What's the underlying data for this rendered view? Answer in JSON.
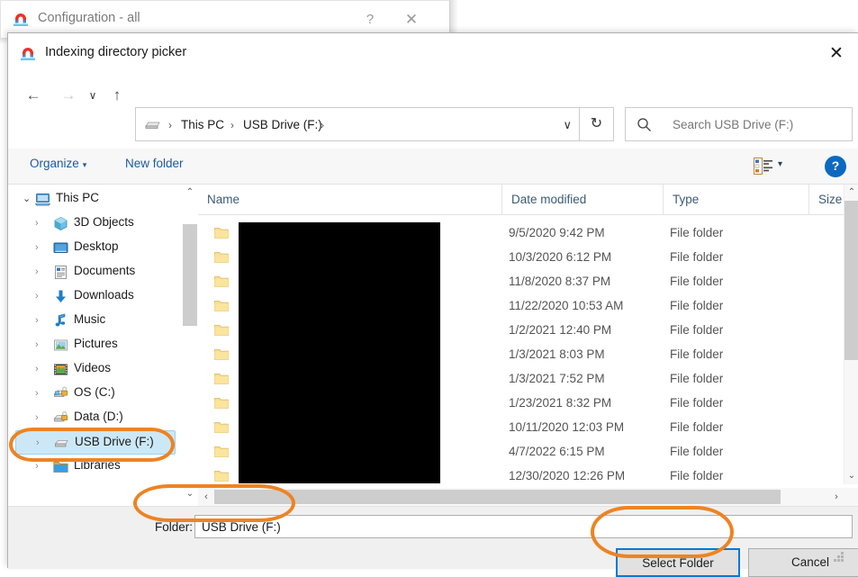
{
  "background_window": {
    "title": "Configuration - all",
    "icon": "everything-magnet-icon",
    "help_label": "?",
    "close_label": "✕"
  },
  "dialog": {
    "title": "Indexing directory picker",
    "icon": "everything-magnet-icon",
    "close_label": "✕"
  },
  "navigation": {
    "back_label": "←",
    "forward_label": "→",
    "recent_label": "∨",
    "up_label": "↑"
  },
  "address_bar": {
    "drive_icon": "usb-drive-icon",
    "crumbs": [
      "This PC",
      "USB Drive (F:)"
    ],
    "separator": "›",
    "dropdown_label": "∨",
    "refresh_label": "↻"
  },
  "search": {
    "icon": "search-icon",
    "placeholder": "Search USB Drive (F:)"
  },
  "toolbar": {
    "organize_label": "Organize",
    "organize_caret": "▾",
    "new_folder_label": "New folder",
    "view_icon": "view-list-icon",
    "view_caret": "▾",
    "help_label": "?"
  },
  "nav_pane": {
    "items": [
      {
        "label": "This PC",
        "level": "root",
        "icon": "this-pc-icon",
        "expanded": true,
        "chevron": "⌄",
        "selected": false
      },
      {
        "label": "3D Objects",
        "level": "child",
        "icon": "3d-objects-icon",
        "expanded": false,
        "chevron": "›",
        "selected": false
      },
      {
        "label": "Desktop",
        "level": "child",
        "icon": "desktop-icon",
        "expanded": false,
        "chevron": "›",
        "selected": false
      },
      {
        "label": "Documents",
        "level": "child",
        "icon": "documents-icon",
        "expanded": false,
        "chevron": "›",
        "selected": false
      },
      {
        "label": "Downloads",
        "level": "child",
        "icon": "downloads-icon",
        "expanded": false,
        "chevron": "›",
        "selected": false
      },
      {
        "label": "Music",
        "level": "child",
        "icon": "music-icon",
        "expanded": false,
        "chevron": "›",
        "selected": false
      },
      {
        "label": "Pictures",
        "level": "child",
        "icon": "pictures-icon",
        "expanded": false,
        "chevron": "›",
        "selected": false
      },
      {
        "label": "Videos",
        "level": "child",
        "icon": "videos-icon",
        "expanded": false,
        "chevron": "›",
        "selected": false
      },
      {
        "label": "OS (C:)",
        "level": "child",
        "icon": "os-drive-icon",
        "expanded": false,
        "chevron": "›",
        "selected": false
      },
      {
        "label": "Data (D:)",
        "level": "child",
        "icon": "hard-drive-icon",
        "expanded": false,
        "chevron": "›",
        "selected": false
      },
      {
        "label": "USB Drive (F:)",
        "level": "child",
        "icon": "usb-drive-icon",
        "expanded": false,
        "chevron": "›",
        "selected": true
      },
      {
        "label": "Libraries",
        "level": "child",
        "icon": "libraries-icon",
        "expanded": false,
        "chevron": "›",
        "selected": false
      }
    ],
    "scroll_up": "⌃",
    "scroll_down": "⌄"
  },
  "file_list": {
    "columns": [
      "Name",
      "Date modified",
      "Type",
      "Size"
    ],
    "sort_indicator": "⌃",
    "name_redacted": true,
    "rows": [
      {
        "name": "",
        "date_modified": "9/5/2020 9:42 PM",
        "type": "File folder",
        "size": ""
      },
      {
        "name": "",
        "date_modified": "10/3/2020 6:12 PM",
        "type": "File folder",
        "size": ""
      },
      {
        "name": "",
        "date_modified": "11/8/2020 8:37 PM",
        "type": "File folder",
        "size": ""
      },
      {
        "name": "",
        "date_modified": "11/22/2020 10:53 AM",
        "type": "File folder",
        "size": ""
      },
      {
        "name": "",
        "date_modified": "1/2/2021 12:40 PM",
        "type": "File folder",
        "size": ""
      },
      {
        "name": "",
        "date_modified": "1/3/2021 8:03 PM",
        "type": "File folder",
        "size": ""
      },
      {
        "name": "",
        "date_modified": "1/3/2021 7:52 PM",
        "type": "File folder",
        "size": ""
      },
      {
        "name": "",
        "date_modified": "1/23/2021 8:32 PM",
        "type": "File folder",
        "size": ""
      },
      {
        "name": "",
        "date_modified": "10/11/2020 12:03 PM",
        "type": "File folder",
        "size": ""
      },
      {
        "name": "",
        "date_modified": "4/7/2022 6:15 PM",
        "type": "File folder",
        "size": ""
      },
      {
        "name": "",
        "date_modified": "12/30/2020 12:26 PM",
        "type": "File folder",
        "size": ""
      }
    ],
    "vscroll_up": "⌃",
    "vscroll_down": "⌄",
    "hscroll_left": "‹",
    "hscroll_right": "›"
  },
  "folder_field": {
    "label": "Folder:",
    "value": "USB Drive (F:)"
  },
  "buttons": {
    "select_folder": "Select Folder",
    "cancel": "Cancel"
  },
  "colors": {
    "annotation_orange": "#ee8322",
    "focus_blue": "#0078d7",
    "selection_blue": "#cce8f7",
    "link_blue": "#1c5ba0",
    "header_text": "#3d5a75"
  }
}
